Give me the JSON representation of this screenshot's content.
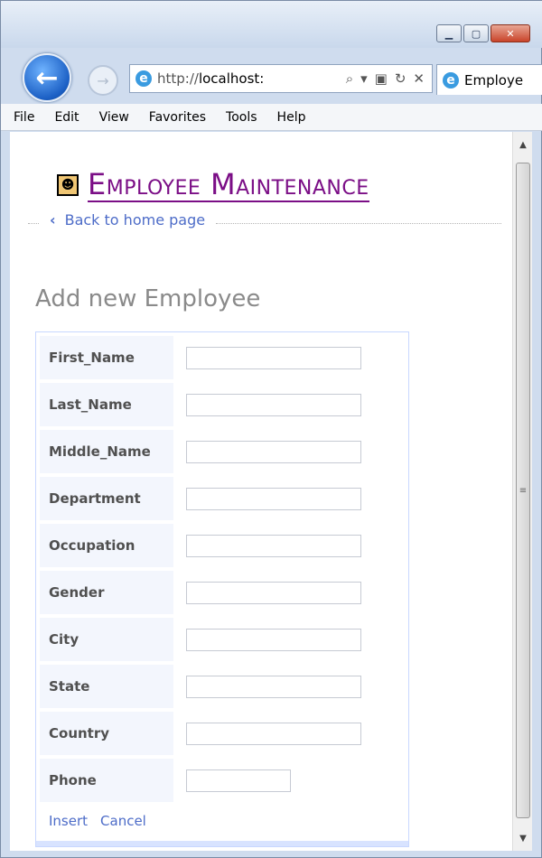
{
  "browser": {
    "address_url_prefix": "http://",
    "address_url_host": "localhost:",
    "tab_title": "Employe",
    "menu": [
      "File",
      "Edit",
      "View",
      "Favorites",
      "Tools",
      "Help"
    ]
  },
  "page": {
    "brand_title": "Employee Maintenance",
    "back_link": "Back to home page",
    "heading": "Add new Employee",
    "fields": [
      {
        "label": "First_Name",
        "value": ""
      },
      {
        "label": "Last_Name",
        "value": ""
      },
      {
        "label": "Middle_Name",
        "value": ""
      },
      {
        "label": "Department",
        "value": ""
      },
      {
        "label": "Occupation",
        "value": ""
      },
      {
        "label": "Gender",
        "value": ""
      },
      {
        "label": "City",
        "value": ""
      },
      {
        "label": "State",
        "value": ""
      },
      {
        "label": "Country",
        "value": ""
      },
      {
        "label": "Phone",
        "value": ""
      }
    ],
    "insert_label": "Insert",
    "cancel_label": "Cancel"
  }
}
